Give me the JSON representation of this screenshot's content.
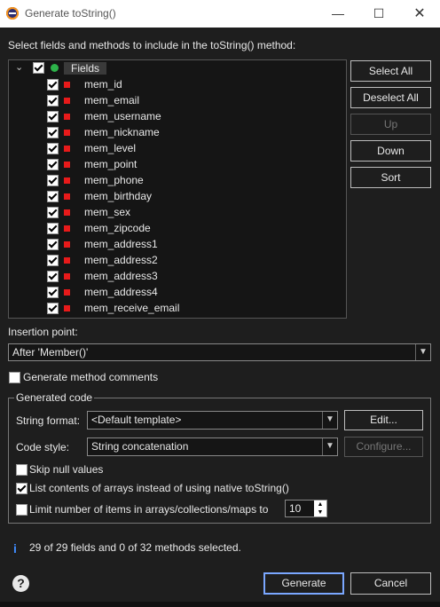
{
  "window": {
    "title": "Generate toString()",
    "minimize": "—",
    "maximize": "☐",
    "close": "✕"
  },
  "instruction": "Select fields and methods to include in the toString() method:",
  "tree": {
    "root_label": "Fields",
    "fields": [
      "mem_id",
      "mem_email",
      "mem_username",
      "mem_nickname",
      "mem_level",
      "mem_point",
      "mem_phone",
      "mem_birthday",
      "mem_sex",
      "mem_zipcode",
      "mem_address1",
      "mem_address2",
      "mem_address3",
      "mem_address4",
      "mem_receive_email"
    ]
  },
  "buttons": {
    "select_all": "Select All",
    "deselect_all": "Deselect All",
    "up": "Up",
    "down": "Down",
    "sort": "Sort"
  },
  "insertion": {
    "label": "Insertion point:",
    "value": "After 'Member()'"
  },
  "generate_comments": {
    "label": "Generate method comments",
    "checked": false
  },
  "generated_code": {
    "title": "Generated code",
    "string_format_label": "String format:",
    "string_format_value": "<Default template>",
    "edit_button": "Edit...",
    "code_style_label": "Code style:",
    "code_style_value": "String concatenation",
    "configure_button": "Configure...",
    "skip_null_label": "Skip null values",
    "list_contents_label": "List contents of arrays instead of using native toString()",
    "limit_label": "Limit number of items in arrays/collections/maps to",
    "limit_value": "10"
  },
  "status": "29 of 29 fields and 0 of 32 methods selected.",
  "footer": {
    "generate": "Generate",
    "cancel": "Cancel"
  },
  "colors": {
    "accent": "#7aa7ff",
    "field_marker": "#e81a1a",
    "root_marker": "#2db34a",
    "info": "#3f8cff"
  }
}
